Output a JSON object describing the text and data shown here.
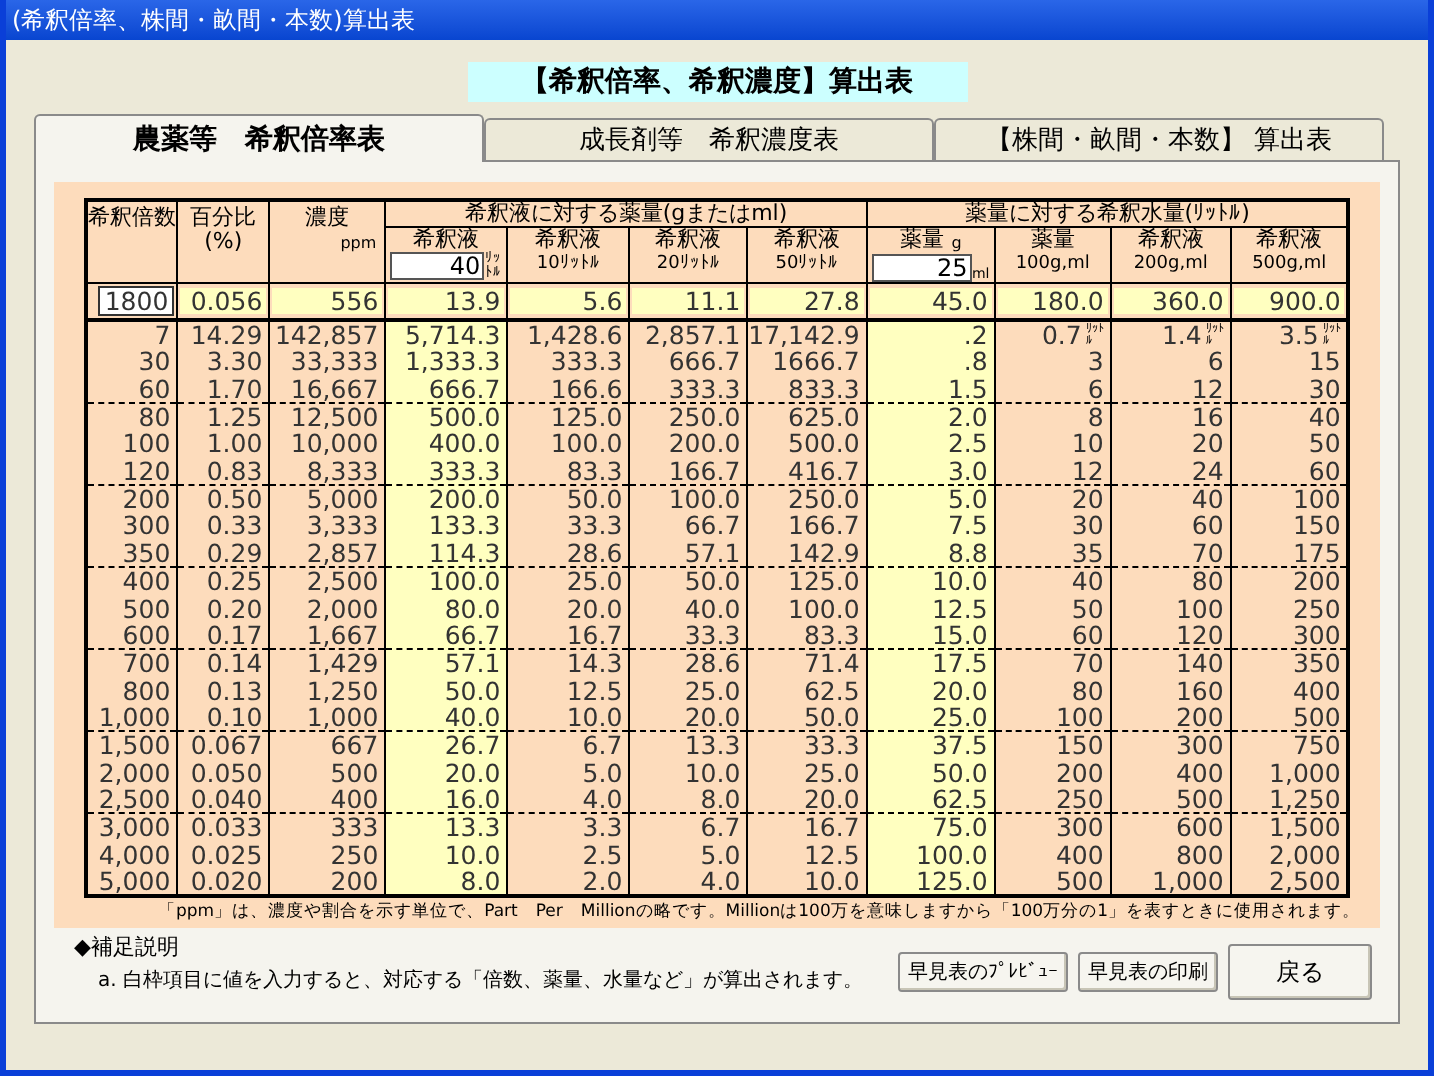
{
  "window": {
    "title": "(希釈倍率、株間・畝間・本数)算出表"
  },
  "banner": "【希釈倍率、希釈濃度】算出表",
  "tabs": [
    {
      "label": "農薬等　希釈倍率表",
      "selected": true
    },
    {
      "label": "成長剤等　希釈濃度表",
      "selected": false
    },
    {
      "label": "【株間・畝間・本数】 算出表",
      "selected": false
    }
  ],
  "table": {
    "columns": [
      {
        "label": "希釈倍数",
        "highlighted": false
      },
      {
        "label": "百分比",
        "sub": "(%)",
        "highlighted": false
      },
      {
        "label": "濃度",
        "unit": "ppm",
        "highlighted": false
      }
    ],
    "groups": [
      {
        "label": "希釈液に対する薬量(gまたはml)",
        "columns": [
          {
            "label": "希釈液",
            "input": "40",
            "unit": "ﾘｯﾄﾙ",
            "highlighted": true
          },
          {
            "label": "希釈液",
            "unit": "10ﾘｯﾄﾙ",
            "highlighted": false
          },
          {
            "label": "希釈液",
            "unit": "20ﾘｯﾄﾙ",
            "highlighted": false
          },
          {
            "label": "希釈液",
            "unit": "50ﾘｯﾄﾙ",
            "highlighted": false
          }
        ]
      },
      {
        "label": "薬量に対する希釈水量(ﾘｯﾄﾙ)",
        "columns": [
          {
            "label": "薬量",
            "unit_top": "g",
            "input": "25",
            "unit": "ml",
            "highlighted": true
          },
          {
            "label": "薬量",
            "unit": "100g,ml",
            "highlighted": false
          },
          {
            "label": "希釈液",
            "unit": "200g,ml",
            "highlighted": false
          },
          {
            "label": "希釈液",
            "unit": "500g,ml",
            "highlighted": false
          }
        ]
      }
    ],
    "input_row": [
      "1800",
      "0.056",
      "556",
      "13.9",
      "5.6",
      "11.1",
      "27.8",
      "45.0",
      "180.0",
      "360.0",
      "900.0"
    ],
    "row_groups": [
      [
        [
          "7",
          "14.29",
          "142,857",
          "5,714.3",
          "1,428.6",
          "2,857.1",
          "17,142.9",
          ".2",
          {
            "value": "0.7",
            "unit": "ﾘｯﾄﾙ"
          },
          {
            "value": "1.4",
            "unit": "ﾘｯﾄﾙ"
          },
          {
            "value": "3.5",
            "unit": "ﾘｯﾄﾙ"
          }
        ],
        [
          "30",
          "3.30",
          "33,333",
          "1,333.3",
          "333.3",
          "666.7",
          "1666.7",
          ".8",
          "3",
          "6",
          "15"
        ],
        [
          "60",
          "1.70",
          "16,667",
          "666.7",
          "166.6",
          "333.3",
          "833.3",
          "1.5",
          "6",
          "12",
          "30"
        ]
      ],
      [
        [
          "80",
          "1.25",
          "12,500",
          "500.0",
          "125.0",
          "250.0",
          "625.0",
          "2.0",
          "8",
          "16",
          "40"
        ],
        [
          "100",
          "1.00",
          "10,000",
          "400.0",
          "100.0",
          "200.0",
          "500.0",
          "2.5",
          "10",
          "20",
          "50"
        ],
        [
          "120",
          "0.83",
          "8,333",
          "333.3",
          "83.3",
          "166.7",
          "416.7",
          "3.0",
          "12",
          "24",
          "60"
        ]
      ],
      [
        [
          "200",
          "0.50",
          "5,000",
          "200.0",
          "50.0",
          "100.0",
          "250.0",
          "5.0",
          "20",
          "40",
          "100"
        ],
        [
          "300",
          "0.33",
          "3,333",
          "133.3",
          "33.3",
          "66.7",
          "166.7",
          "7.5",
          "30",
          "60",
          "150"
        ],
        [
          "350",
          "0.29",
          "2,857",
          "114.3",
          "28.6",
          "57.1",
          "142.9",
          "8.8",
          "35",
          "70",
          "175"
        ]
      ],
      [
        [
          "400",
          "0.25",
          "2,500",
          "100.0",
          "25.0",
          "50.0",
          "125.0",
          "10.0",
          "40",
          "80",
          "200"
        ],
        [
          "500",
          "0.20",
          "2,000",
          "80.0",
          "20.0",
          "40.0",
          "100.0",
          "12.5",
          "50",
          "100",
          "250"
        ],
        [
          "600",
          "0.17",
          "1,667",
          "66.7",
          "16.7",
          "33.3",
          "83.3",
          "15.0",
          "60",
          "120",
          "300"
        ]
      ],
      [
        [
          "700",
          "0.14",
          "1,429",
          "57.1",
          "14.3",
          "28.6",
          "71.4",
          "17.5",
          "70",
          "140",
          "350"
        ],
        [
          "800",
          "0.13",
          "1,250",
          "50.0",
          "12.5",
          "25.0",
          "62.5",
          "20.0",
          "80",
          "160",
          "400"
        ],
        [
          "1,000",
          "0.10",
          "1,000",
          "40.0",
          "10.0",
          "20.0",
          "50.0",
          "25.0",
          "100",
          "200",
          "500"
        ]
      ],
      [
        [
          "1,500",
          "0.067",
          "667",
          "26.7",
          "6.7",
          "13.3",
          "33.3",
          "37.5",
          "150",
          "300",
          "750"
        ],
        [
          "2,000",
          "0.050",
          "500",
          "20.0",
          "5.0",
          "10.0",
          "25.0",
          "50.0",
          "200",
          "400",
          "1,000"
        ],
        [
          "2,500",
          "0.040",
          "400",
          "16.0",
          "4.0",
          "8.0",
          "20.0",
          "62.5",
          "250",
          "500",
          "1,250"
        ]
      ],
      [
        [
          "3,000",
          "0.033",
          "333",
          "13.3",
          "3.3",
          "6.7",
          "16.7",
          "75.0",
          "300",
          "600",
          "1,500"
        ],
        [
          "4,000",
          "0.025",
          "250",
          "10.0",
          "2.5",
          "5.0",
          "12.5",
          "100.0",
          "400",
          "800",
          "2,000"
        ],
        [
          "5,000",
          "0.020",
          "200",
          "8.0",
          "2.0",
          "4.0",
          "10.0",
          "125.0",
          "500",
          "1,000",
          "2,500"
        ]
      ]
    ]
  },
  "footnote": "「ppm」は、濃度や割合を示す単位で、Part　Per　Millionの略です。Millionは100万を意味しますから「100万分の1」を表すときに使用されます。",
  "notes": {
    "heading": "◆補足説明",
    "lines": [
      "a. 白枠項目に値を入力すると、対応する「倍数、薬量、水量など」が算出されます。"
    ]
  },
  "buttons": [
    {
      "label": "早見表のﾌﾟﾚﾋﾞｭｰ",
      "kind": "small"
    },
    {
      "label": "早見表の印刷",
      "kind": "small"
    },
    {
      "label": "戻る",
      "kind": "large"
    }
  ]
}
